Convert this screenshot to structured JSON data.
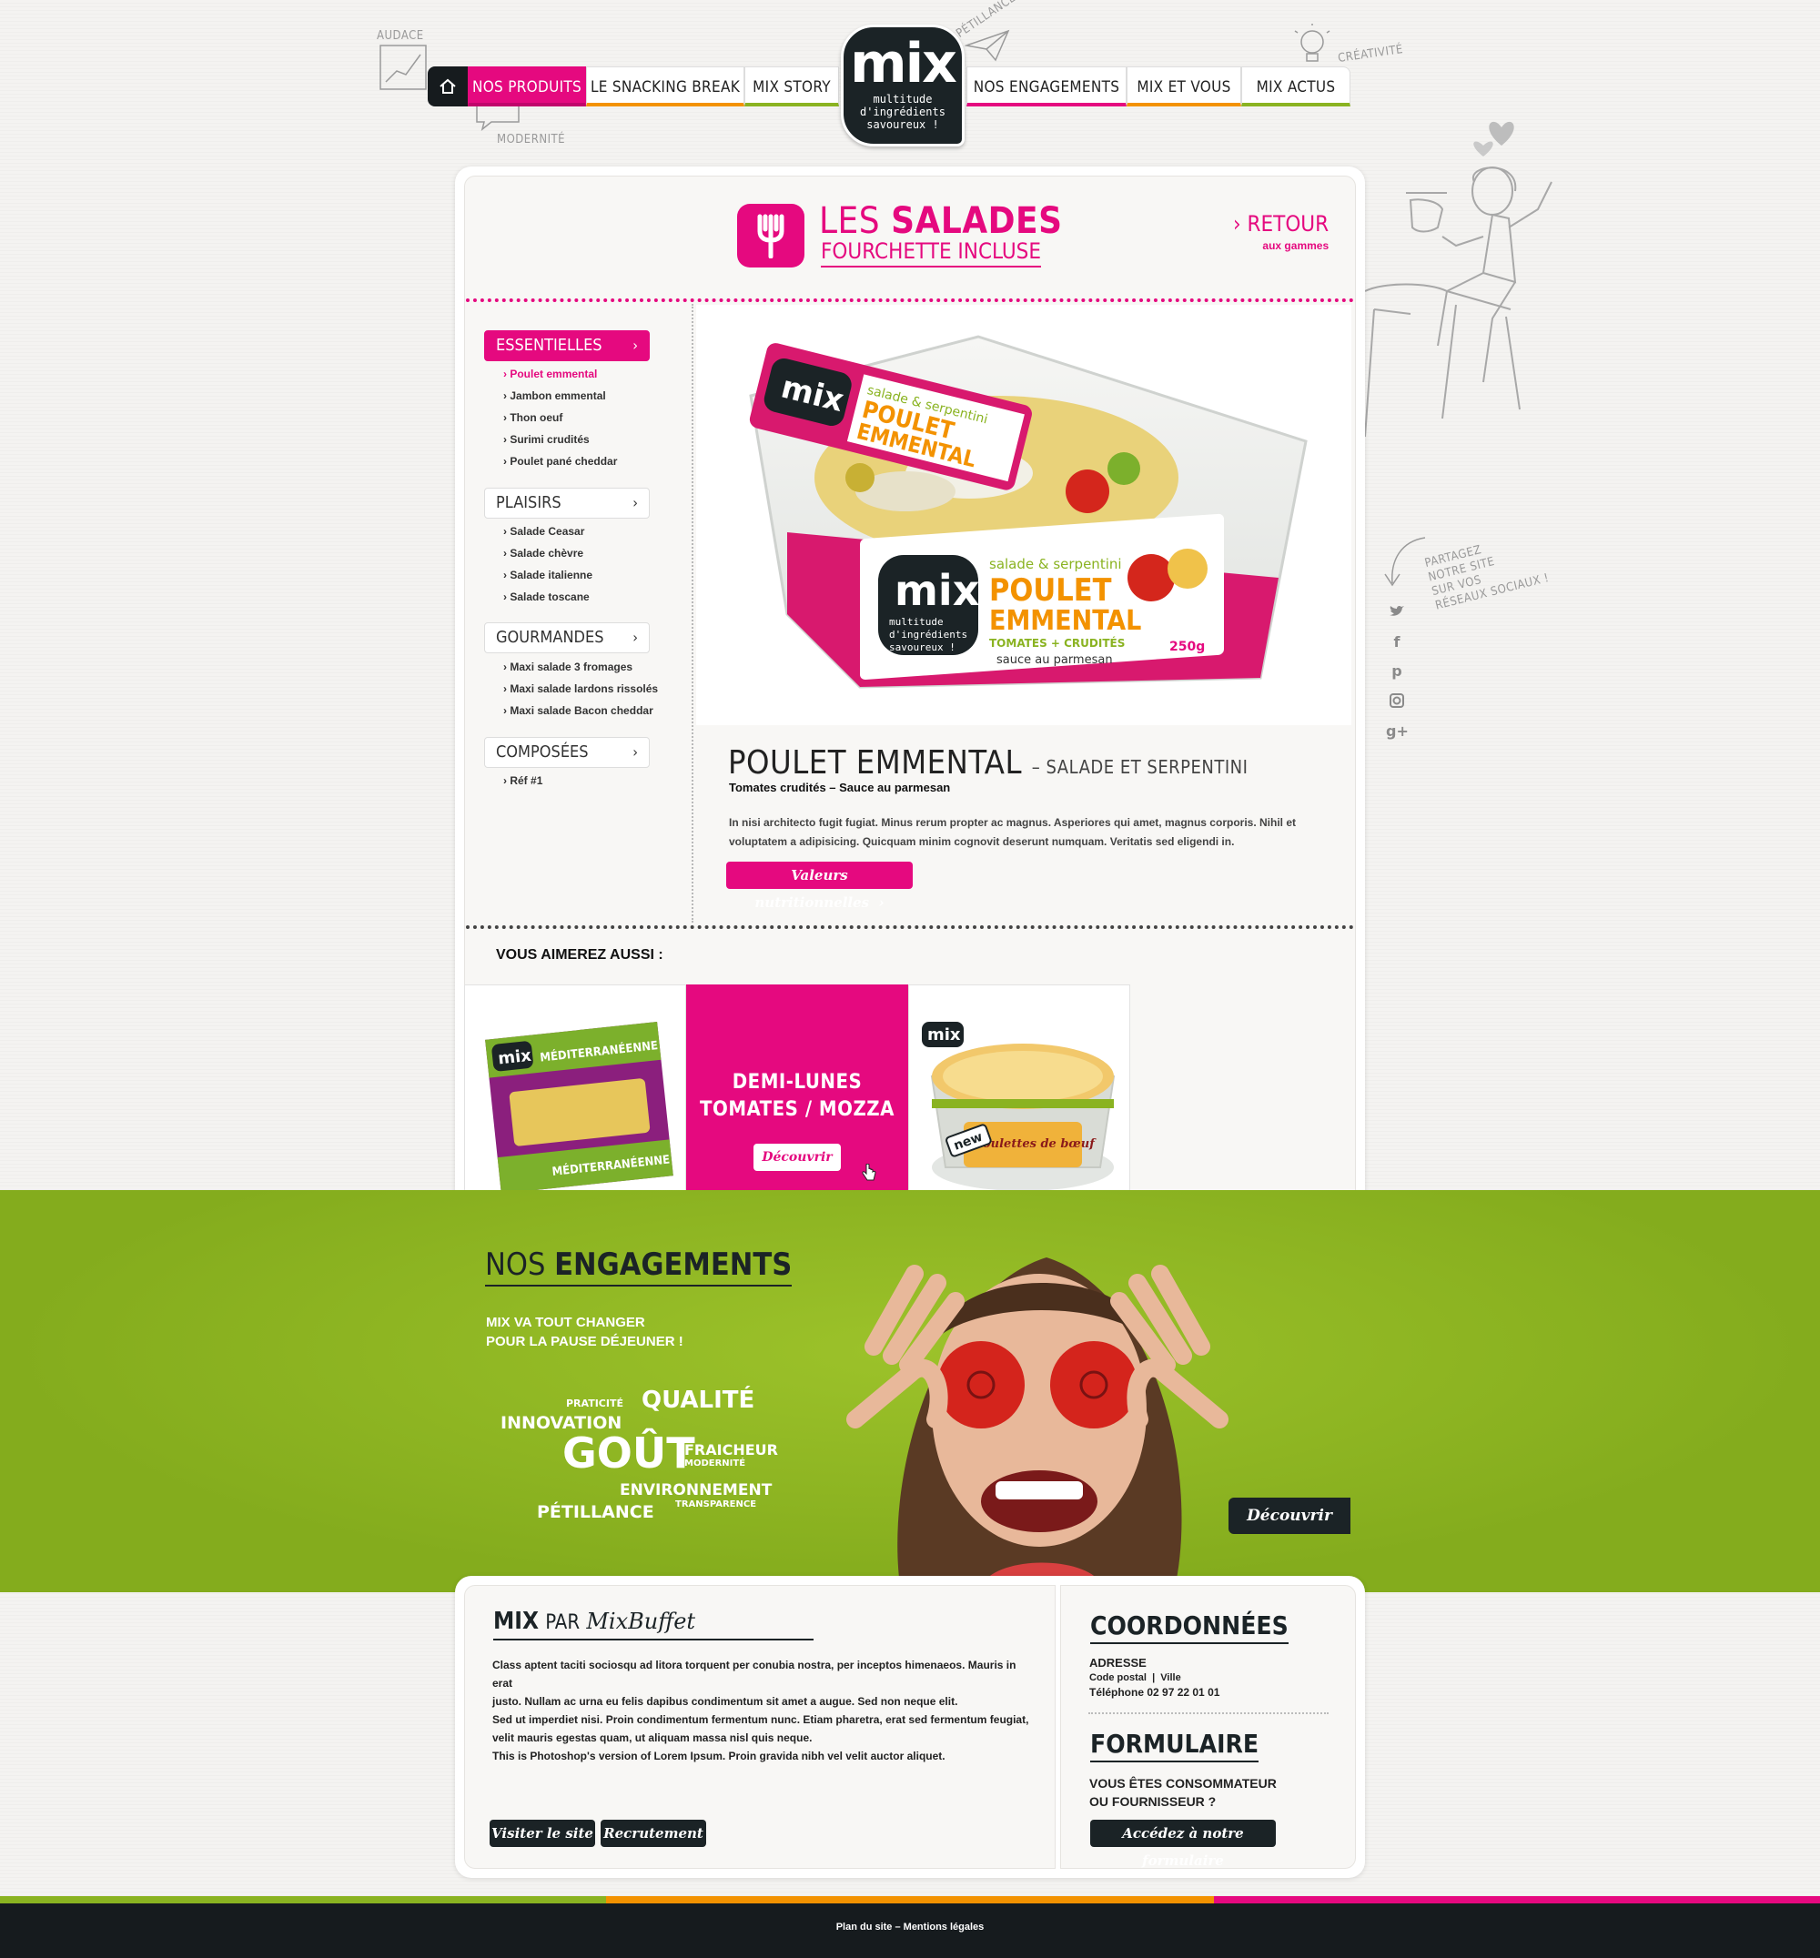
{
  "nav": {
    "items": [
      "NOS PRODUITS",
      "LE SNACKING BREAK",
      "MIX STORY",
      "NOS ENGAGEMENTS",
      "MIX ET VOUS",
      "MIX ACTUS"
    ],
    "colors": [
      "#e5097f",
      "#f39200",
      "#8ab321",
      "#e5097f",
      "#f39200",
      "#8ab321"
    ]
  },
  "logo": {
    "main": "mix",
    "line1": "multitude",
    "line2": "d'ingrédients",
    "line3": "savoureux !"
  },
  "doodles": {
    "audace": "AUDACE",
    "modernite": "MODERNITÉ",
    "petillance": "PÉTILLANCE",
    "creativite": "CRÉATIVITÉ"
  },
  "share": {
    "line1": "PARTAGEZ",
    "line2": "NOTRE SITE",
    "line3": "SUR VOS",
    "line4": "RÉSEAUX SOCIAUX !"
  },
  "category": {
    "title_light": "LES",
    "title_bold": "SALADES",
    "subtitle": "FOURCHETTE INCLUSE"
  },
  "retour": {
    "label": "› RETOUR",
    "sub": "aux gammes"
  },
  "sidebar": [
    {
      "label": "ESSENTIELLES",
      "items": [
        "Poulet emmental",
        "Jambon emmental",
        "Thon oeuf",
        "Surimi crudités",
        "Poulet pané cheddar"
      ]
    },
    {
      "label": "PLAISIRS",
      "items": [
        "Salade Ceasar",
        "Salade chèvre",
        "Salade italienne",
        "Salade toscane"
      ]
    },
    {
      "label": "GOURMANDES",
      "items": [
        "Maxi salade 3 fromages",
        "Maxi salade lardons rissolés",
        "Maxi salade Bacon cheddar"
      ]
    },
    {
      "label": "COMPOSÉES",
      "items": [
        "Réf #1"
      ]
    }
  ],
  "package": {
    "top": "salade & serpentini",
    "name1": "POULET",
    "name2": "EMMENTAL",
    "tag": "TOMATES + CRUDITÉS",
    "sauce": "sauce au parmesan",
    "weight": "250g"
  },
  "product": {
    "title": "POULET EMMENTAL",
    "title_suffix": "– SALADE ET SERPENTINI",
    "subtitle": "Tomates crudités – Sauce au parmesan",
    "description": "In nisi architecto fugit fugiat. Minus rerum propter ac magnus. Asperiores qui amet, magnus corporis. Nihil et voluptatem a adipisicing. Quicquam minim cognovit deserunt numquam. Veritatis sed eligendi in.",
    "button": "Valeurs nutritionnelles"
  },
  "also": {
    "title": "VOUS AIMEREZ AUSSI :",
    "featured_line1": "DEMI-LUNES",
    "featured_line2": "TOMATES / MOZZA",
    "button": "Découvrir",
    "pack1_label": "MÉDITERRANÉENNE",
    "pack2_label": "Boulettes de bœuf",
    "pack2_badge": "new"
  },
  "engagements": {
    "title_light": "NOS",
    "title_bold": "ENGAGEMENTS",
    "tag_line1": "MIX VA TOUT CHANGER",
    "tag_line2": "POUR LA PAUSE DÉJEUNER !",
    "words": [
      "PRATICITÉ",
      "QUALITÉ",
      "INNOVATION",
      "GOÛT",
      "FRAICHEUR",
      "MODERNITÉ",
      "ENVIRONNEMENT",
      "TRANSPARENCE",
      "PÉTILLANCE"
    ],
    "button": "Découvrir"
  },
  "footer": {
    "mix": "MIX",
    "par": "PAR",
    "brand": "MixBuffet",
    "text_lines": [
      "Class aptent taciti sociosqu ad litora torquent per conubia nostra, per inceptos himenaeos. Mauris in erat",
      "justo. Nullam ac urna eu felis dapibus condimentum sit amet a augue. Sed non neque elit.",
      "Sed ut imperdiet nisi. Proin condimentum fermentum nunc. Etiam pharetra, erat sed fermentum feugiat,",
      "velit mauris egestas quam, ut aliquam massa nisl quis neque.",
      "This is Photoshop's version  of Lorem Ipsum. Proin gravida nibh vel velit auctor aliquet."
    ],
    "btn_site": "Visiter le site",
    "btn_recrut": "Recrutement",
    "coord_title": "COORDONNÉES",
    "adresse": "ADRESSE",
    "code_postal": "Code postal",
    "ville": "Ville",
    "telephone": "Téléphone 02 97 22 01 01",
    "form_title": "FORMULAIRE",
    "form_q1": "VOUS ÊTES CONSOMMATEUR",
    "form_q2": "OU FOURNISSEUR ?",
    "form_btn": "Accédez à notre formulaire"
  },
  "bottom": {
    "links": "Plan du site – Mentions légales"
  },
  "colors": {
    "pink": "#e5097f",
    "green": "#8ab321",
    "orange": "#f39200",
    "dark": "#1b2326"
  }
}
